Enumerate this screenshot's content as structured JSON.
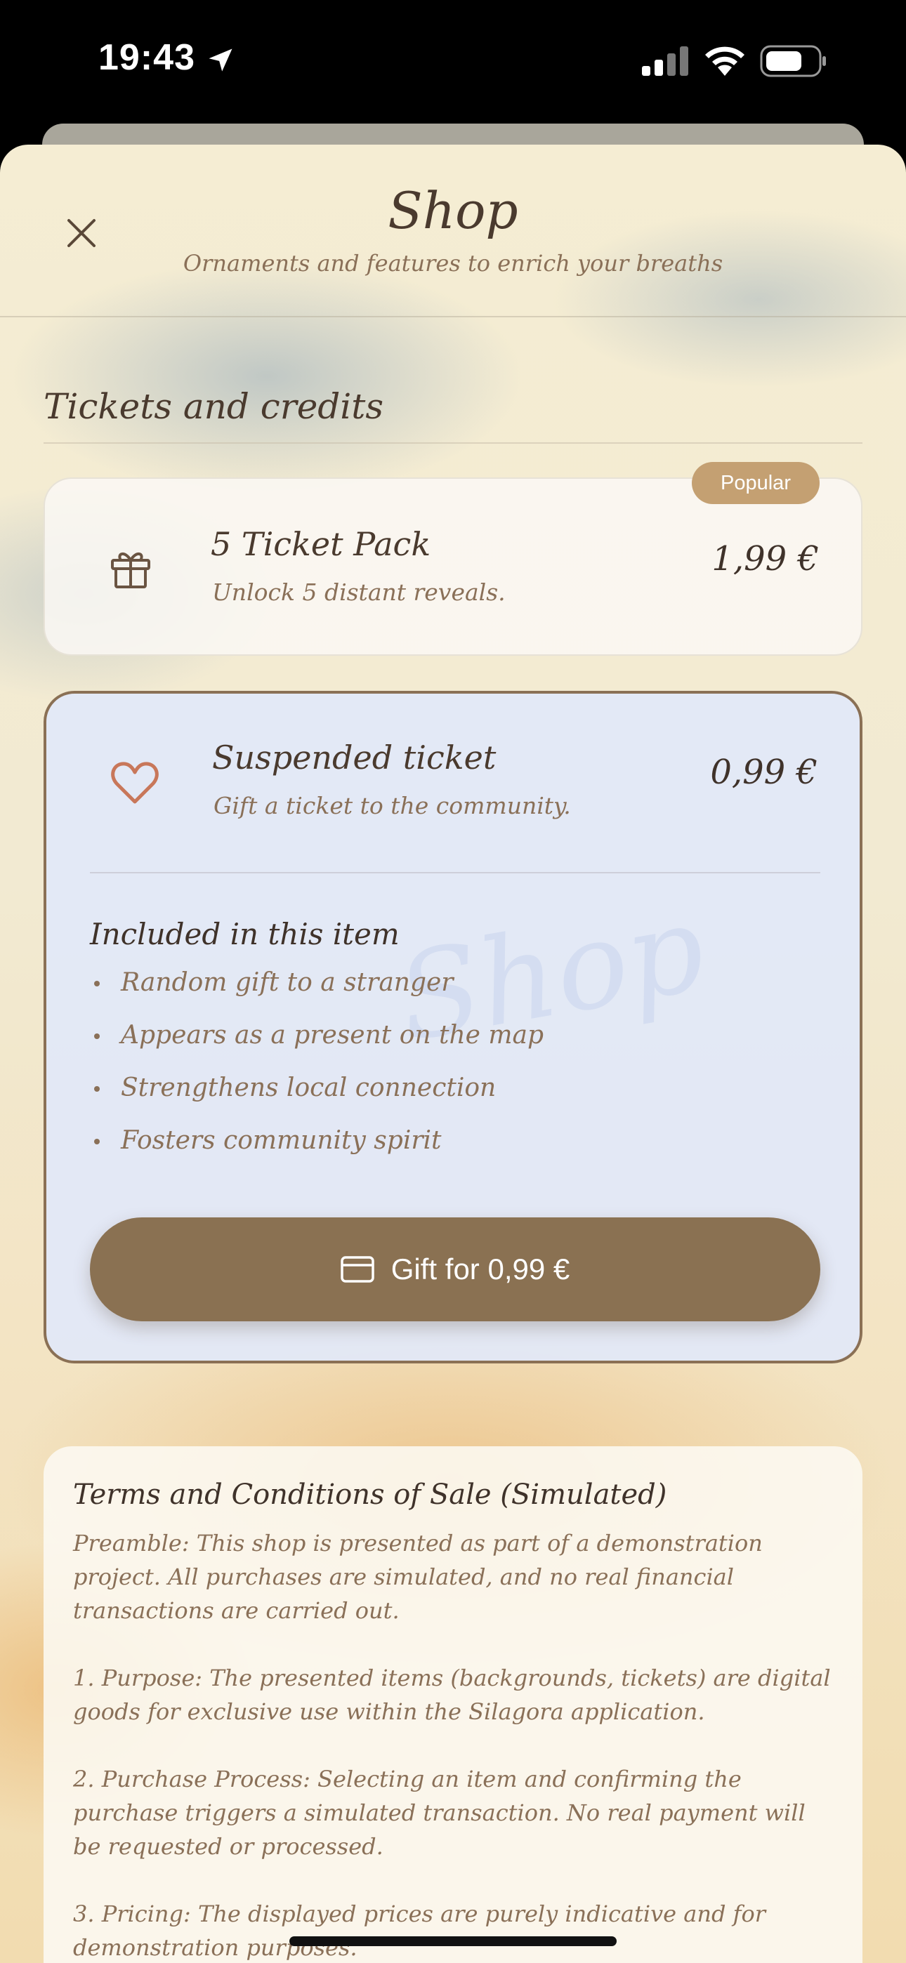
{
  "status_bar": {
    "time": "19:43"
  },
  "header": {
    "title": "Shop",
    "subtitle": "Ornaments and features to enrich your breaths"
  },
  "section": {
    "title": "Tickets and credits"
  },
  "items": [
    {
      "name": "5 Ticket Pack",
      "description": "Unlock 5 distant reveals.",
      "price": "1,99 €",
      "badge": "Popular",
      "icon": "gift-icon"
    },
    {
      "name": "Suspended ticket",
      "description": "Gift a ticket to the community.",
      "price": "0,99 €",
      "icon": "heart-icon",
      "included_title": "Included in this item",
      "features": [
        "Random gift to a stranger",
        "Appears as a present on the map",
        "Strengthens local connection",
        "Fosters community spirit"
      ],
      "button_label": "Gift for 0,99 €",
      "watermark": "Shop"
    }
  ],
  "terms": {
    "title": "Terms and Conditions of Sale (Simulated)",
    "paragraphs": [
      "Preamble: This shop is presented as part of a demonstration project. All purchases are simulated, and no real financial transactions are carried out.",
      "1. Purpose: The presented items (backgrounds, tickets) are digital goods for exclusive use within the Silagora application.",
      "2. Purchase Process: Selecting an item and confirming the purchase triggers a simulated transaction. No real payment will be requested or processed.",
      "3. Pricing: The displayed prices are purely indicative and for demonstration purposes."
    ]
  },
  "colors": {
    "accent": "#8a7152",
    "badge": "#c4a072",
    "selected_card_bg": "#e2e8f8",
    "heart": "#c8775a"
  }
}
